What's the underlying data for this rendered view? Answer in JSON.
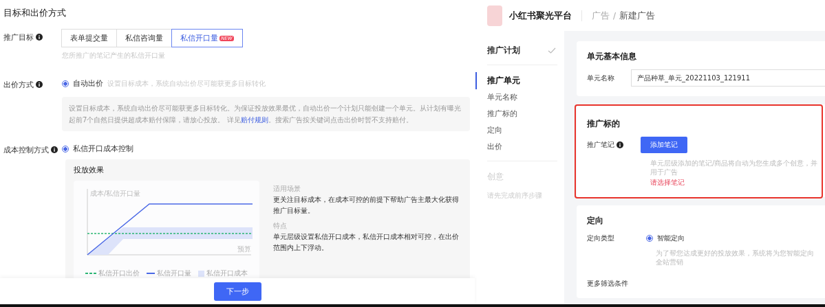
{
  "left": {
    "section_title": "目标和出价方式",
    "goal": {
      "label": "推广目标",
      "tabs": [
        {
          "label": "表单提交量",
          "selected": false
        },
        {
          "label": "私信咨询量",
          "selected": false
        },
        {
          "label": "私信开口量",
          "selected": true,
          "badge": "NEW"
        }
      ],
      "hint": "您所推广的笔记产生的私信开口量"
    },
    "bid": {
      "label": "出价方式",
      "option": {
        "label": "自动出价",
        "selected": true
      },
      "hint": "设置目标成本，系统自动出价尽可能获更多目标转化",
      "notice": {
        "before": "设置目标成本，系统自动出价尽可能获更多目标转化。为保证投放效果最优，自动出价一个计划只能创建一个单元。从计划有曝光起前7个自然日提供超成本赔付保障，请放心投放。 详见",
        "link": "赔付规则",
        "after": "。搜索广告按关键词点击出价时暂不支持赔付。"
      }
    },
    "cost": {
      "label": "成本控制方式",
      "option": {
        "label": "私信开口成本控制",
        "selected": true
      },
      "effect": {
        "title": "投放效果",
        "y_axis": "成本/私信开口量",
        "x_axis": "预算",
        "legend": [
          {
            "kind": "dashed",
            "label": "私信开口出价",
            "color": "#2bb673"
          },
          {
            "kind": "line",
            "label": "私信开口量",
            "color": "#4a68e6"
          },
          {
            "kind": "area",
            "label": "私信开口成本",
            "color": "#dde3fa"
          }
        ],
        "scenario_title": "适用场景",
        "scenario": "更关注目标成本，在成本可控的前提下帮助广告主最大化获得推广目标量。",
        "feature_title": "特点",
        "feature": "单元层级设置私信开口成本，私信开口成本相对可控，在出价范围内上下浮动。"
      }
    },
    "next_button": "下一步"
  },
  "right": {
    "brand": "小红书聚光平台",
    "breadcrumb_separator": "/",
    "breadcrumb": [
      {
        "label": "广告",
        "current": false
      },
      {
        "label": "新建广告",
        "current": true
      }
    ],
    "sidebar": [
      {
        "kind": "step",
        "label": "推广计划",
        "selected": false,
        "done": true,
        "disabled": false
      },
      {
        "kind": "step",
        "label": "推广单元",
        "selected": true,
        "done": false,
        "disabled": false
      },
      {
        "kind": "sub",
        "label": "单元名称"
      },
      {
        "kind": "sub",
        "label": "推广标的"
      },
      {
        "kind": "sub",
        "label": "定向"
      },
      {
        "kind": "sub",
        "label": "出价"
      },
      {
        "kind": "step",
        "label": "创意",
        "selected": false,
        "done": false,
        "disabled": true
      },
      {
        "kind": "note",
        "label": "请先完成前序步骤"
      }
    ],
    "basic": {
      "title": "单元基本信息",
      "name_label": "单元名称",
      "name_value": "产品种草_单元_20221103_121911"
    },
    "target": {
      "title": "推广标的",
      "note_label": "推广笔记",
      "add_button": "添加笔记",
      "hint": "单元层级添加的笔记/商品将自动为您生成多个创意，并用于广告",
      "error": "请选择笔记",
      "highlighted": true
    },
    "targeting": {
      "title": "定向",
      "type_label": "定向类型",
      "option": {
        "label": "智能定向",
        "selected": true
      },
      "hint": "为了帮您达成更好的投放效果，系统将为您智能定向全站营销",
      "more_label": "更多筛选条件"
    }
  }
}
